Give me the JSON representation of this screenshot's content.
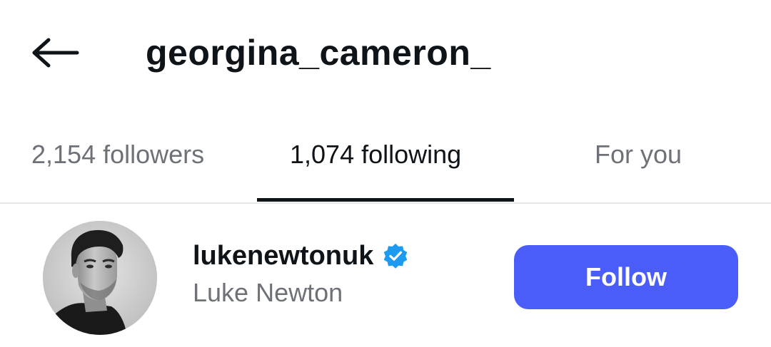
{
  "header": {
    "title": "georgina_cameron_",
    "back_icon": "arrow-left-icon"
  },
  "tabs": [
    {
      "label": "2,154 followers",
      "active": false
    },
    {
      "label": "1,074 following",
      "active": true
    },
    {
      "label": "For you",
      "active": false
    }
  ],
  "list": {
    "items": [
      {
        "username": "lukenewtonuk",
        "display_name": "Luke Newton",
        "verified": true,
        "button_label": "Follow"
      }
    ]
  },
  "colors": {
    "accent": "#4a5df9",
    "verified_badge": "#1d9bf0",
    "text_primary": "#0f1419",
    "text_secondary": "#6e7178",
    "divider": "#e6e7ea"
  }
}
